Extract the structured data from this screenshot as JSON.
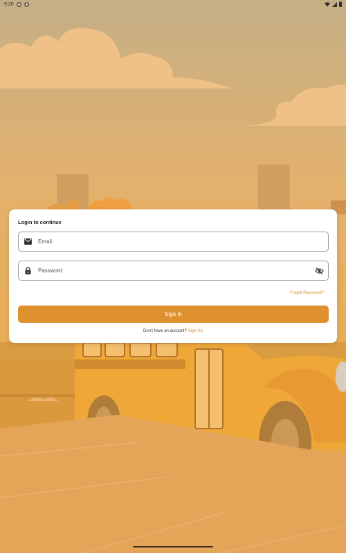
{
  "status_bar": {
    "time": "9:20",
    "icons": [
      "shield-icon",
      "notification-icon",
      "wifi-icon",
      "signal-icon",
      "battery-icon"
    ]
  },
  "login_card": {
    "title": "Login to continue",
    "email": {
      "placeholder": "Email",
      "value": "",
      "icon": "mail-icon"
    },
    "password": {
      "placeholder": "Password",
      "value": "",
      "icon": "lock-icon",
      "toggle_icon": "eye-off-icon"
    },
    "forgot_password": "Forgot Password?",
    "sign_in_label": "Sign In",
    "signup_prompt": "Don't have an account?",
    "signup_link": "Sign Up"
  },
  "colors": {
    "accent": "#df902f",
    "link": "#d8902a",
    "background": "#d9a35a"
  }
}
